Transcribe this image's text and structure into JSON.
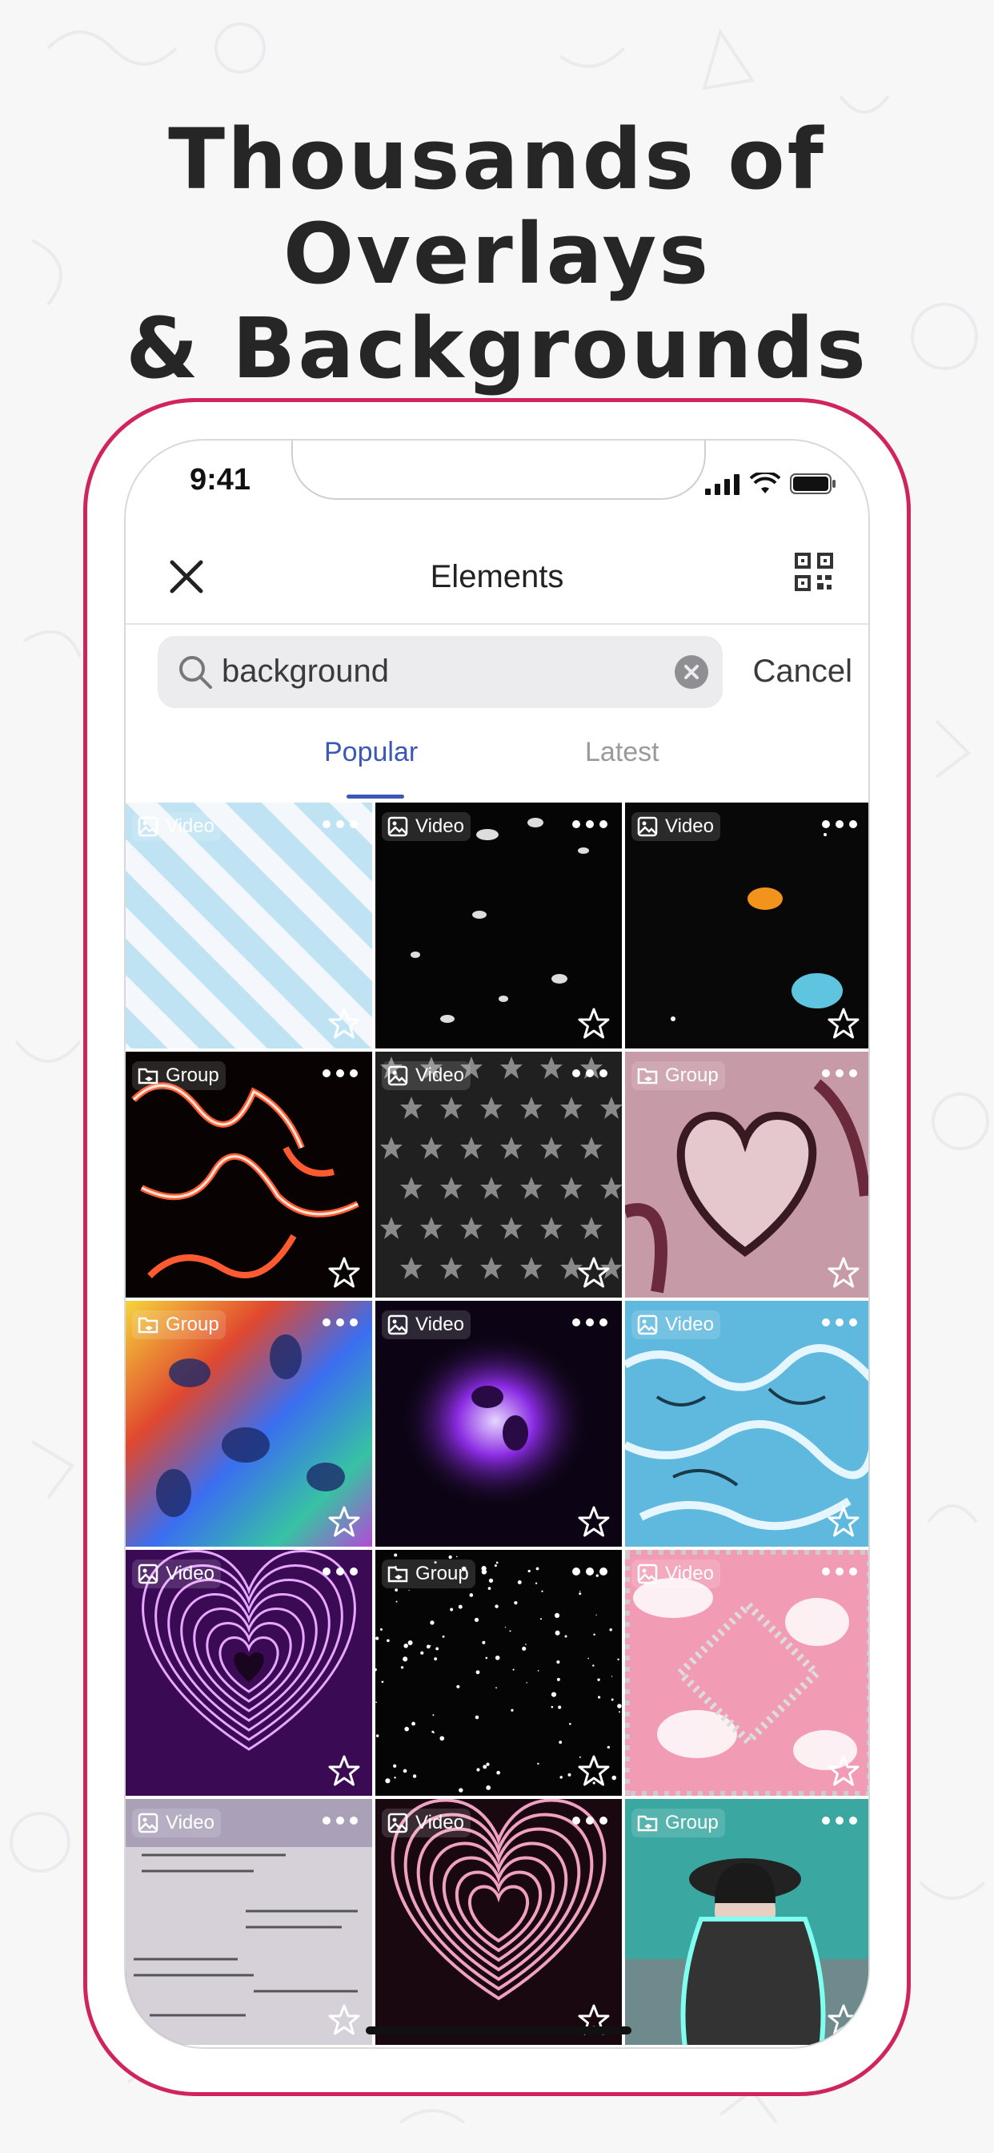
{
  "headline": {
    "line1": "Thousands of Overlays",
    "line2": "& Backgrounds"
  },
  "status_bar": {
    "time": "9:41"
  },
  "nav": {
    "title": "Elements",
    "close_icon": "close-icon",
    "qr_icon": "qr-code-icon"
  },
  "search": {
    "value": "background",
    "cancel_label": "Cancel"
  },
  "tabs": [
    {
      "label": "Popular",
      "active": true
    },
    {
      "label": "Latest",
      "active": false
    }
  ],
  "tiles": [
    {
      "type": "Video",
      "art": "stripes-blue"
    },
    {
      "type": "Video",
      "art": "petals-dark"
    },
    {
      "type": "Video",
      "art": "butterflies"
    },
    {
      "type": "Group",
      "art": "fire-lines"
    },
    {
      "type": "Video",
      "art": "stars-grid"
    },
    {
      "type": "Group",
      "art": "hearts-pink"
    },
    {
      "type": "Group",
      "art": "rainbow-blobs"
    },
    {
      "type": "Video",
      "art": "purple-smoke"
    },
    {
      "type": "Video",
      "art": "blue-water"
    },
    {
      "type": "Video",
      "art": "neon-heart"
    },
    {
      "type": "Group",
      "art": "starfield"
    },
    {
      "type": "Video",
      "art": "pink-diamond"
    },
    {
      "type": "Video",
      "art": "newspaper"
    },
    {
      "type": "Video",
      "art": "pink-heart"
    },
    {
      "type": "Group",
      "art": "person-neon"
    }
  ],
  "colors": {
    "accent": "#3b58b4",
    "frame": "#d0245c",
    "headline": "#262626"
  }
}
